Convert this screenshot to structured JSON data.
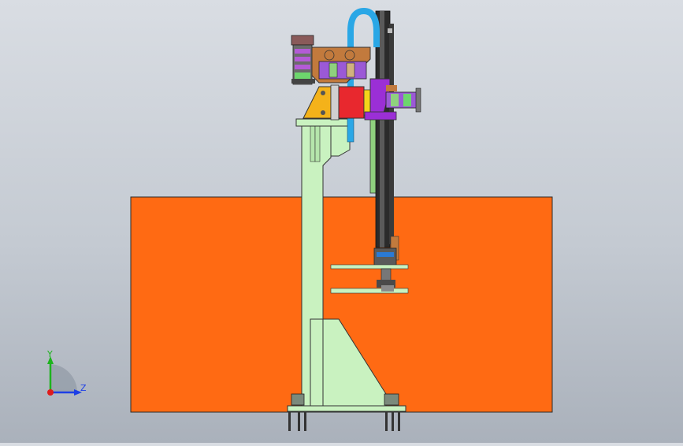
{
  "viewport": {
    "background_top": "#d9dde3",
    "background_bottom": "#aab1bb"
  },
  "model": {
    "panel_color": "#ff6a13",
    "column_color": "#c9f2c0",
    "rail_color": "#1a1a1a",
    "motor_color": "#e8282e",
    "bracket_color": "#f4b21a",
    "hose_color": "#2aa7e6",
    "cylinder_color": "#9b59d6",
    "arm_plate_color": "#c27a3d"
  },
  "triad": {
    "x_label": "",
    "y_label": "Y",
    "z_label": "Z",
    "y_color": "#1db31d",
    "z_color": "#1e3fe6",
    "x_color": "#e01b1b",
    "y_icon": "axis-y-arrow-icon",
    "z_icon": "axis-z-arrow-icon",
    "origin_icon": "axis-origin-icon"
  }
}
